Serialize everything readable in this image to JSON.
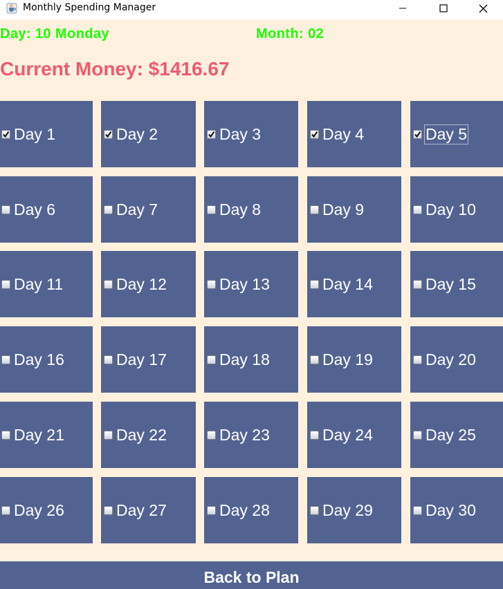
{
  "window": {
    "title": "Monthly Spending Manager",
    "icon": "java-cup-icon",
    "controls": [
      "minimize-icon",
      "maximize-icon",
      "close-icon"
    ]
  },
  "header": {
    "day_text": "Day: 10 Monday",
    "month_text": "Month: 02",
    "money_text": "Current Money: $1416.67"
  },
  "colors": {
    "background": "#fff1de",
    "cell": "#536391",
    "day_text": "#1aff00",
    "money_text": "#ef5b6e",
    "cell_text": "#ffffff"
  },
  "days": [
    {
      "label": "Day 1",
      "checked": true
    },
    {
      "label": "Day 2",
      "checked": true
    },
    {
      "label": "Day 3",
      "checked": true
    },
    {
      "label": "Day 4",
      "checked": true
    },
    {
      "label": "Day 5",
      "checked": true,
      "focused": true
    },
    {
      "label": "Day 6",
      "checked": false
    },
    {
      "label": "Day 7",
      "checked": false
    },
    {
      "label": "Day 8",
      "checked": false
    },
    {
      "label": "Day 9",
      "checked": false
    },
    {
      "label": "Day 10",
      "checked": false
    },
    {
      "label": "Day 11",
      "checked": false
    },
    {
      "label": "Day 12",
      "checked": false
    },
    {
      "label": "Day 13",
      "checked": false
    },
    {
      "label": "Day 14",
      "checked": false
    },
    {
      "label": "Day 15",
      "checked": false
    },
    {
      "label": "Day 16",
      "checked": false
    },
    {
      "label": "Day 17",
      "checked": false
    },
    {
      "label": "Day 18",
      "checked": false
    },
    {
      "label": "Day 19",
      "checked": false
    },
    {
      "label": "Day 20",
      "checked": false
    },
    {
      "label": "Day 21",
      "checked": false
    },
    {
      "label": "Day 22",
      "checked": false
    },
    {
      "label": "Day 23",
      "checked": false
    },
    {
      "label": "Day 24",
      "checked": false
    },
    {
      "label": "Day 25",
      "checked": false
    },
    {
      "label": "Day 26",
      "checked": false
    },
    {
      "label": "Day 27",
      "checked": false
    },
    {
      "label": "Day 28",
      "checked": false
    },
    {
      "label": "Day 29",
      "checked": false
    },
    {
      "label": "Day 30",
      "checked": false
    }
  ],
  "footer": {
    "back_label": "Back to Plan"
  }
}
